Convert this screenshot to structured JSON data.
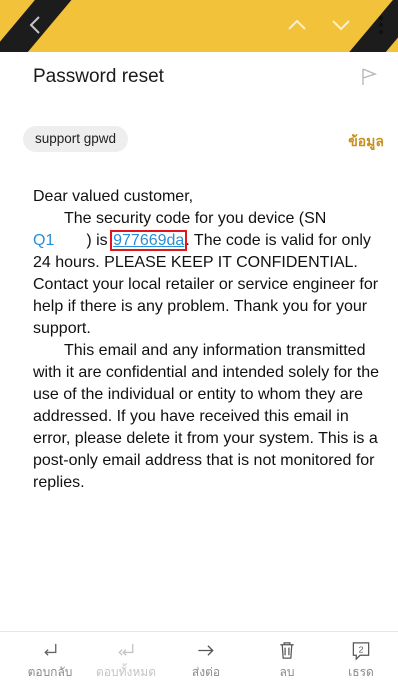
{
  "toolbar": {
    "icons": [
      "back-arrow-icon",
      "chevron-up-icon",
      "chevron-down-icon",
      "more-vert-icon"
    ],
    "accent_color": "#f2c23a"
  },
  "email": {
    "subject": "Password reset",
    "sender": "support gpwd",
    "details_label": "ข้อมูล",
    "body": {
      "greeting": "Dear valued customer,",
      "p1_a": "The security code for you device (SN",
      "sn_value": "Q1",
      "p1_b": ") is",
      "code": "977669da",
      "p1_c": ". The code is valid for only 24 hours. PLEASE KEEP IT CONFIDENTIAL. Contact your local retailer or service engineer for help if there is any problem. Thank you for your support.",
      "p2": "This email and any information transmitted with it are confidential and intended solely for the use of the individual or entity to whom they are addressed. If you have received this email in error, please delete it from your system. This is a post-only email address that is not monitored for replies."
    }
  },
  "bottom_bar": {
    "reply": "ตอบกลับ",
    "reply_all": "ตอบทั้งหมด",
    "forward": "ส่งต่อ",
    "delete": "ลบ",
    "thread": "เธรด",
    "thread_count": "2"
  }
}
